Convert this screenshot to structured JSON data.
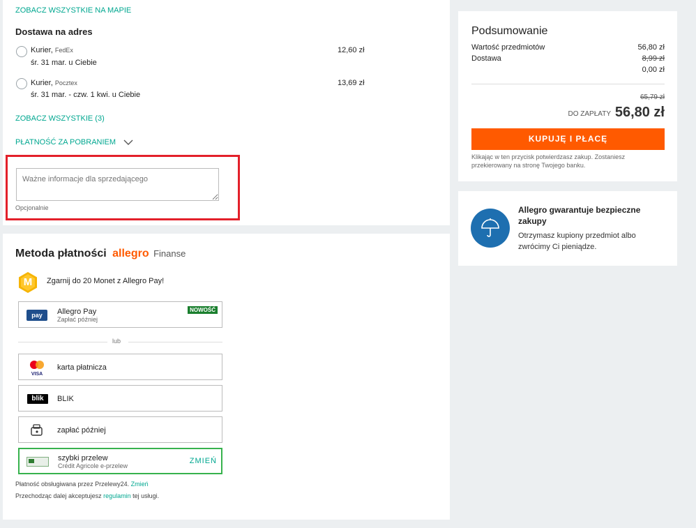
{
  "delivery": {
    "map_link": "ZOBACZ WSZYSTKIE NA MAPIE",
    "address_heading": "Dostawa na adres",
    "options": [
      {
        "method": "Kurier,",
        "carrier": "FedEx",
        "date": "śr. 31 mar. u Ciebie",
        "price": "12,60 zł"
      },
      {
        "method": "Kurier,",
        "carrier": "Pocztex",
        "date": "śr. 31 mar. - czw. 1 kwi. u Ciebie",
        "price": "13,69 zł"
      }
    ],
    "see_all": "ZOBACZ WSZYSTKIE (3)",
    "cod": "PŁATNOŚĆ ZA POBRANIEM",
    "note_placeholder": "Ważne informacje dla sprzedającego",
    "note_hint": "Opcjonalnie"
  },
  "payment": {
    "heading": "Metoda płatności",
    "brand": "allegro",
    "brand_suffix": "Finanse",
    "coins_promo": "Zgarnij do 20 Monet z Allegro Pay!",
    "coin_letter": "M",
    "allegro_pay": {
      "name": "Allegro Pay",
      "sub": "Zapłać później",
      "badge": "NOWOŚĆ",
      "icon_text": "pay"
    },
    "divider": "lub",
    "options": [
      {
        "label": "karta płatnicza",
        "icon": "card-icon",
        "icon_text": "VISA"
      },
      {
        "label": "BLIK",
        "icon": "blik-icon",
        "icon_text": "blik"
      },
      {
        "label": "zapłać później",
        "icon": "wallet-icon"
      }
    ],
    "selected": {
      "name": "szybki przelew",
      "sub": "Crédit Agricole e-przelew",
      "action": "ZMIEŃ"
    },
    "footer_line1_a": "Płatność obsługiwana przez Przelewy24. ",
    "footer_line1_link": "Zmień",
    "footer_line2_a": "Przechodząc dalej akceptujesz ",
    "footer_line2_link": "regulamin",
    "footer_line2_b": " tej usługi."
  },
  "summary": {
    "title": "Podsumowanie",
    "items_label": "Wartość przedmiotów",
    "items_value": "56,80 zł",
    "shipping_label": "Dostawa",
    "shipping_old": "8,99 zł",
    "shipping_new": "0,00 zł",
    "total_old": "65,79 zł",
    "total_label": "DO ZAPŁATY",
    "total_value": "56,80 zł",
    "buy_button": "KUPUJĘ I PŁACĘ",
    "disclaimer_1": "Klikając w ten przycisk potwierdzasz zakup. Zostaniesz",
    "disclaimer_2": "przekierowany na stronę Twojego banku."
  },
  "guarantee": {
    "title_1": "Allegro gwarantuje bezpieczne",
    "title_2": "zakupy",
    "text_1": "Otrzymasz kupiony przedmiot albo",
    "text_2": "zwrócimy Ci pieniądze."
  },
  "colors": {
    "accent": "#00a790",
    "orange": "#ff5a00",
    "highlight": "#e3202a",
    "brand_blue": "#1e6fb0",
    "selected_border": "#37b24d"
  }
}
